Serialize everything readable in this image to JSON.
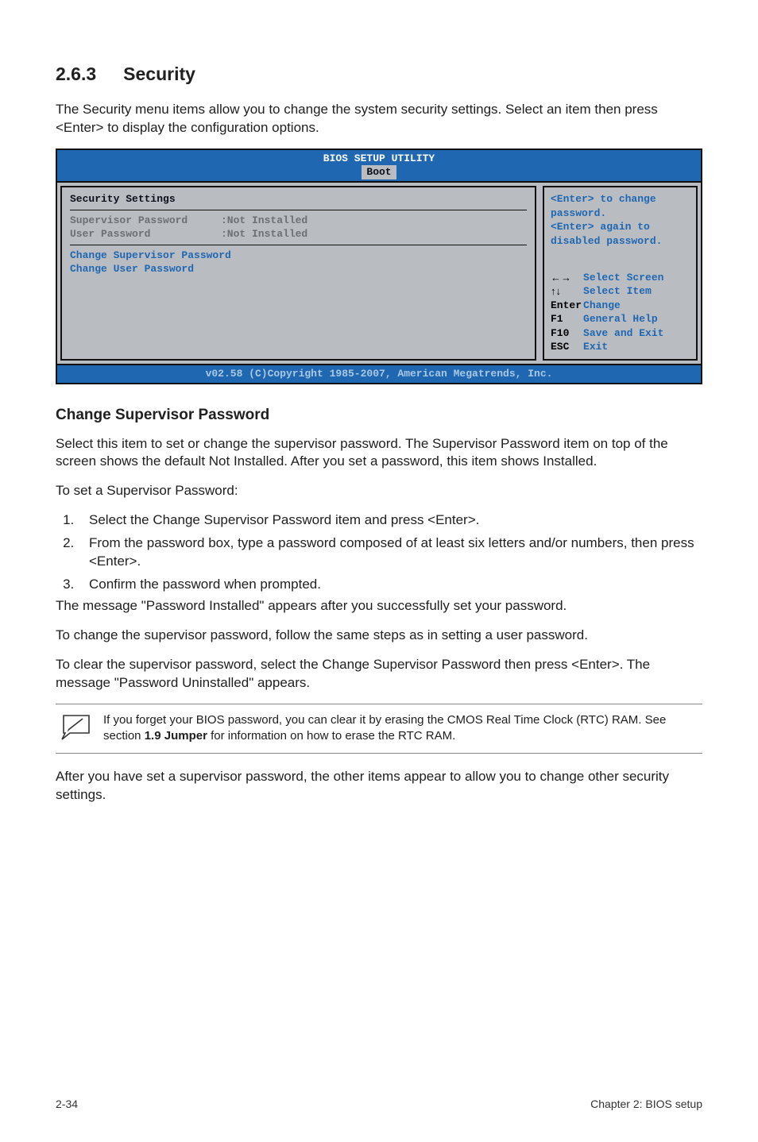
{
  "heading": {
    "number": "2.6.3",
    "title": "Security"
  },
  "intro": "The Security menu items allow you to change the system security settings. Select an item then press <Enter> to display the configuration options.",
  "bios": {
    "title": "BIOS SETUP UTILITY",
    "tab": "Boot",
    "left": {
      "title": "Security Settings",
      "rows": [
        {
          "label": "Supervisor Password",
          "value": ":Not Installed"
        },
        {
          "label": "User Password",
          "value": ":Not Installed"
        }
      ],
      "actions": [
        "Change Supervisor Password",
        "Change User Password"
      ]
    },
    "right": {
      "help": "<Enter> to change password.\n<Enter> again to disabled password.",
      "nav": [
        {
          "key": "←→",
          "label": "Select Screen"
        },
        {
          "key": "↑↓",
          "label": "Select Item"
        },
        {
          "key": "Enter",
          "label": "Change"
        },
        {
          "key": "F1",
          "label": "General Help"
        },
        {
          "key": "F10",
          "label": "Save and Exit"
        },
        {
          "key": "ESC",
          "label": "Exit"
        }
      ]
    },
    "footer": "v02.58 (C)Copyright 1985-2007, American Megatrends, Inc."
  },
  "sub": {
    "heading": "Change Supervisor Password",
    "p1": "Select this item to set or change the supervisor password. The Supervisor Password item on top of the screen shows the default Not Installed. After you set a password, this item shows Installed.",
    "p2": "To set a Supervisor Password:",
    "ol": [
      "Select the Change Supervisor Password item and press <Enter>.",
      "From the password box, type a password composed of at least six letters and/or numbers, then press <Enter>.",
      "Confirm the password when prompted."
    ],
    "p3": "The message \"Password Installed\" appears after you successfully set your password.",
    "p4": "To change the supervisor password, follow the same steps as in setting a user password.",
    "p5": "To clear the supervisor password, select the Change Supervisor Password then press <Enter>. The message \"Password Uninstalled\" appears."
  },
  "note": {
    "pre": "If you forget your BIOS password, you can clear it by erasing the CMOS Real Time Clock (RTC) RAM. See section ",
    "bold": "1.9 Jumper",
    "post": " for information on how to erase the RTC RAM."
  },
  "after_note": "After you have set a supervisor password, the other items appear to allow you to change other security settings.",
  "footer": {
    "left": "2-34",
    "right": "Chapter 2: BIOS setup"
  }
}
